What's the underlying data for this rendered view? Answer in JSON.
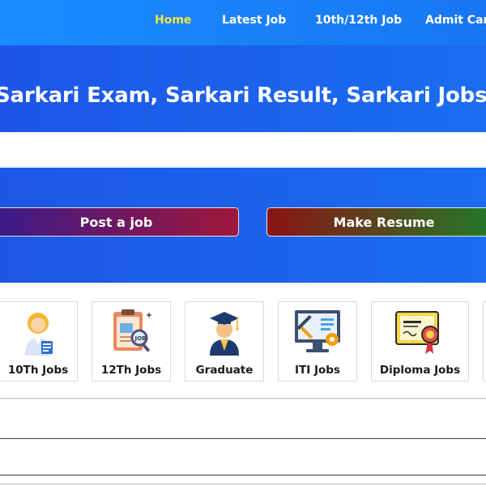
{
  "nav": {
    "items": [
      {
        "label": "Home",
        "active": true
      },
      {
        "label": "Latest Job",
        "active": false
      },
      {
        "label": "10th/12th Job",
        "active": false
      },
      {
        "label": "Admit Card",
        "active": false
      }
    ]
  },
  "hero": {
    "title": "Sarkari Exam, Sarkari Result, Sarkari Jobs"
  },
  "actions": {
    "post_job": "Post a job",
    "make_resume": "Make Resume"
  },
  "categories": [
    {
      "label": "10Th Jobs",
      "icon": "student-icon"
    },
    {
      "label": "12Th Jobs",
      "icon": "clipboard-search-icon"
    },
    {
      "label": "Graduate",
      "icon": "graduate-icon"
    },
    {
      "label": "ITI Jobs",
      "icon": "tools-monitor-icon"
    },
    {
      "label": "Diploma Jobs",
      "icon": "certificate-icon"
    }
  ],
  "colors": {
    "nav_bg": "#1a8cff",
    "active_nav": "#f5e642",
    "hero_bg": "#1c5ee8"
  }
}
